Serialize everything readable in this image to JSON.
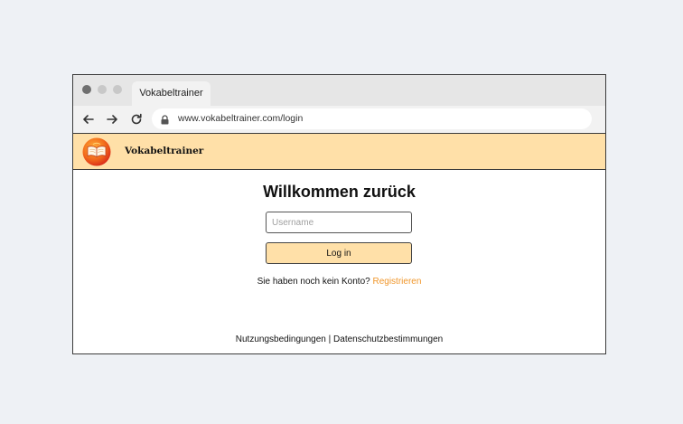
{
  "browser": {
    "tab_title": "Vokabeltrainer",
    "url": "www.vokabeltrainer.com/login",
    "traffic_light_colors": [
      "#6f6f6f",
      "#c8c8c8",
      "#c8c8c8"
    ]
  },
  "app": {
    "name": "Vokabeltrainer",
    "header_color": "#ffe0a8",
    "logo_icon": "book-icon"
  },
  "login": {
    "title": "Willkommen zurück",
    "username_placeholder": "Username",
    "username_value": "",
    "button_label": "Log in",
    "register_prompt": "Sie haben noch kein Konto?",
    "register_link": "Registrieren",
    "link_color": "#f0962a"
  },
  "footer": {
    "terms": "Nutzungsbedingungen",
    "separator": "|",
    "privacy": "Datenschutzbestimmungen"
  }
}
